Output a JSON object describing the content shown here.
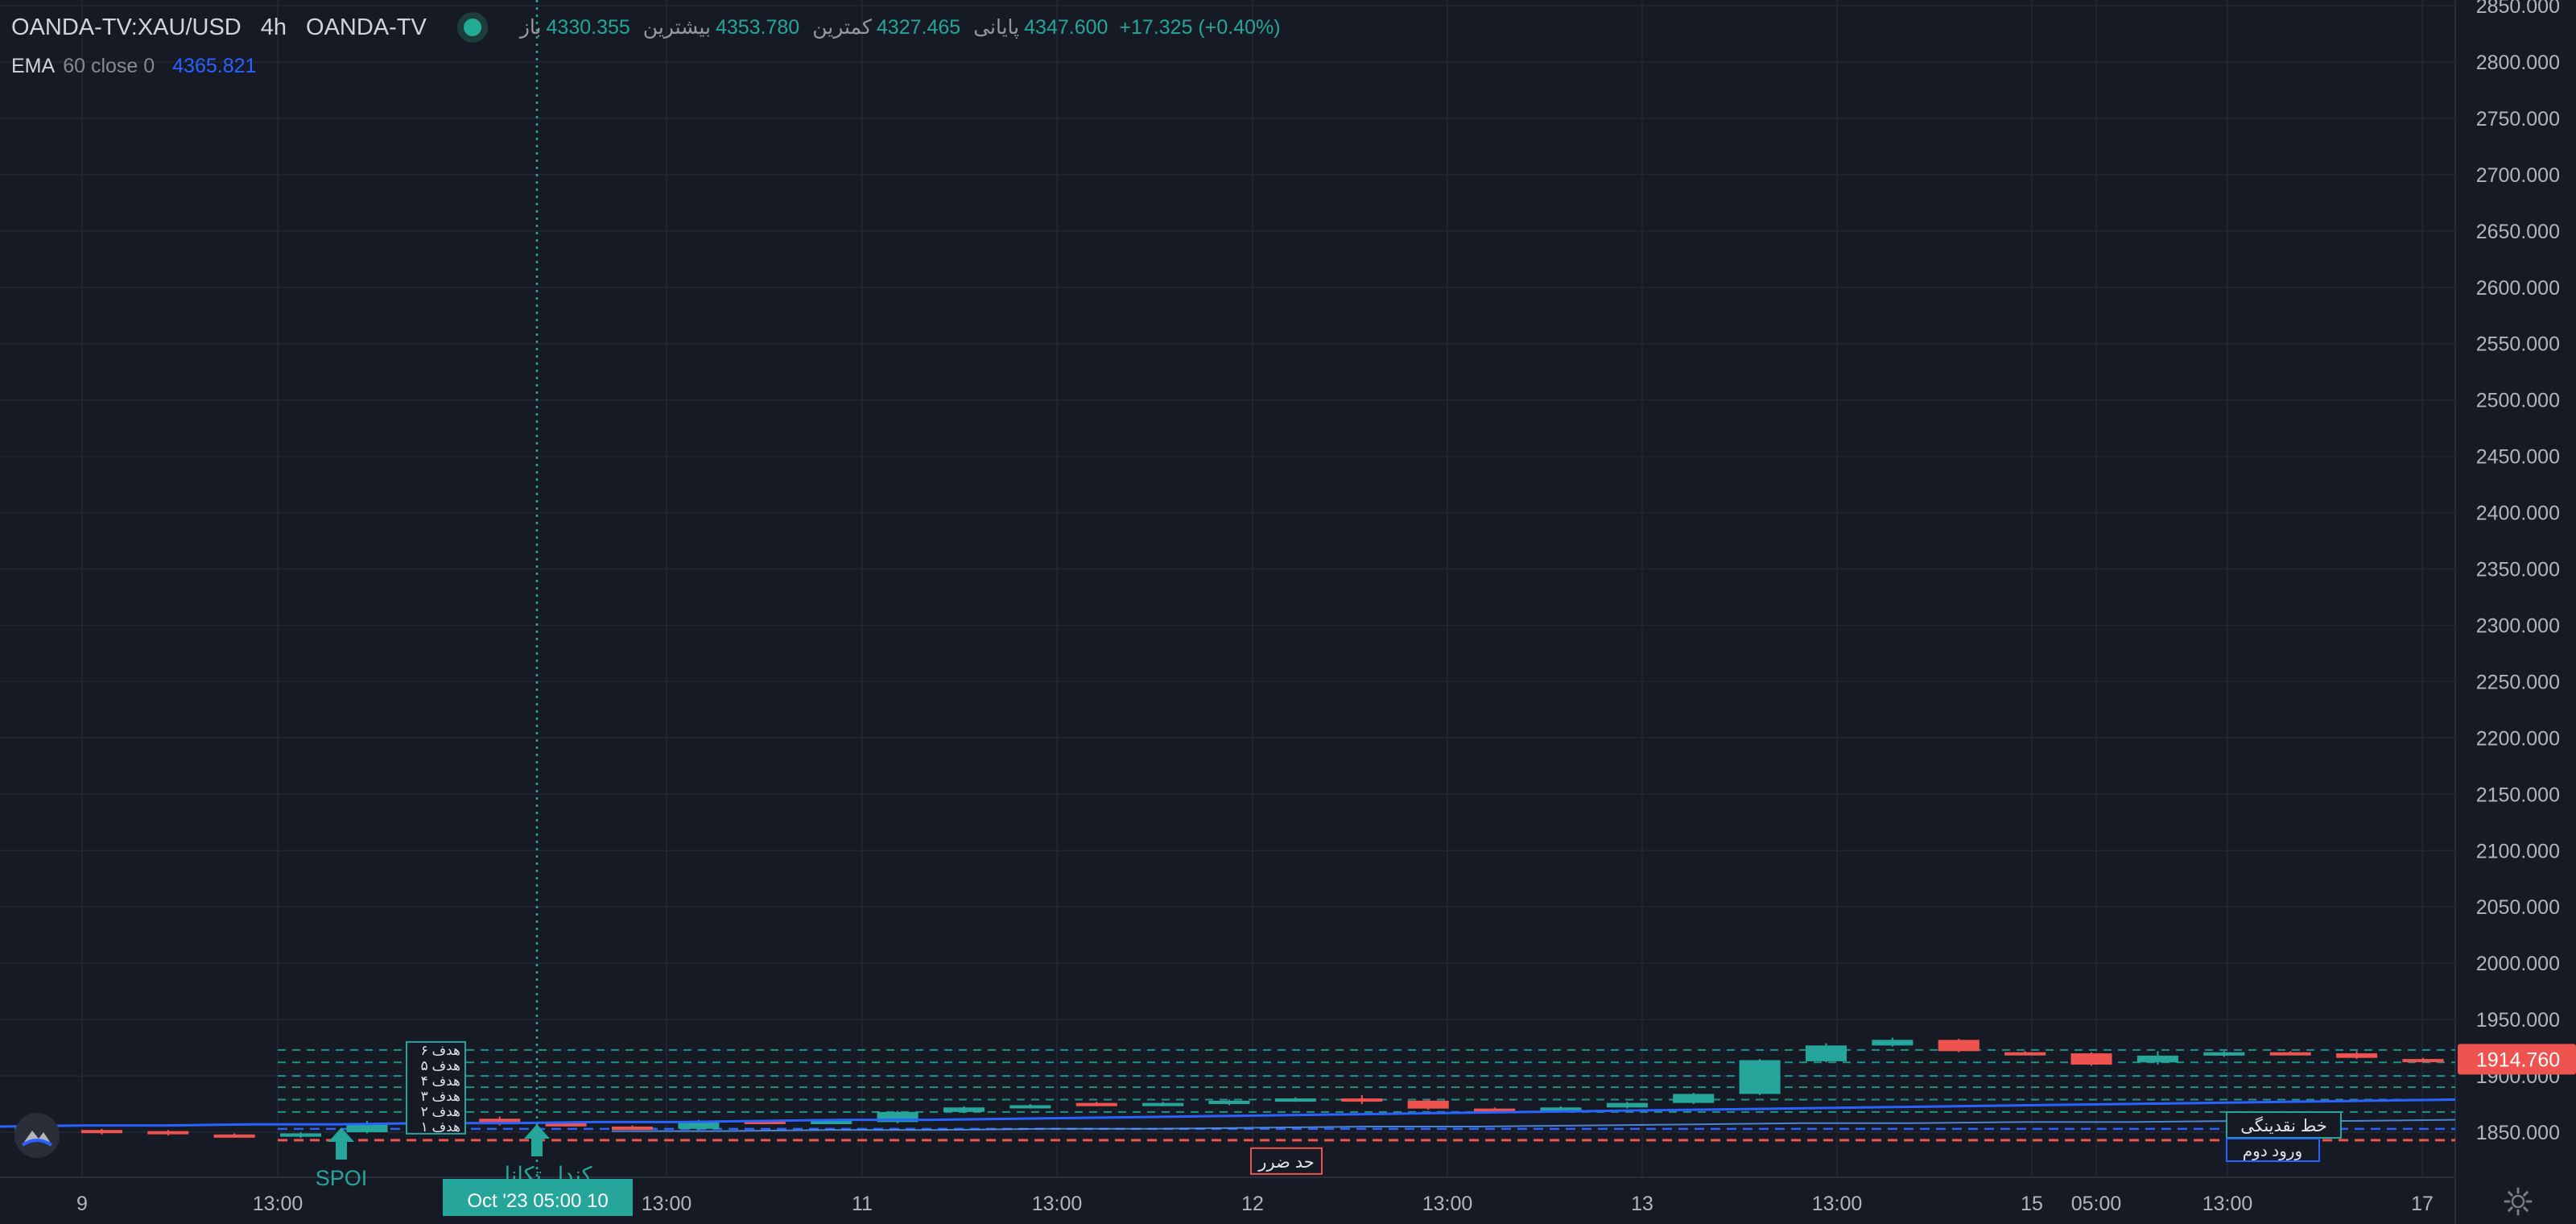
{
  "header": {
    "symbol": "OANDA-TV:XAU/USD",
    "interval": "4h",
    "source": "OANDA-TV",
    "ohlc": [
      {
        "label": "باز",
        "value": "4330.355"
      },
      {
        "label": "بیشترین",
        "value": "4353.780"
      },
      {
        "label": "کمترین",
        "value": "4327.465"
      },
      {
        "label": "پایانی",
        "value": "4347.600"
      }
    ],
    "change": "+17.325 (+0.40%)"
  },
  "indicator": {
    "name": "EMA",
    "params": "60 close 0",
    "value": "4365.821"
  },
  "colors": {
    "background": "#161a25",
    "up": "#26a69a",
    "down": "#ef5350",
    "ema": "#2962ff",
    "text": "#b2b5be"
  },
  "chart_data": {
    "type": "candlestick",
    "y_axis": {
      "range": [
        1810,
        2855
      ],
      "ticks": [
        "2850.000",
        "2800.000",
        "2750.000",
        "2700.000",
        "2650.000",
        "2600.000",
        "2550.000",
        "2500.000",
        "2450.000",
        "2400.000",
        "2350.000",
        "2300.000",
        "2250.000",
        "2200.000",
        "2150.000",
        "2100.000",
        "2050.000",
        "2000.000",
        "1950.000",
        "1900.000",
        "1850.000"
      ]
    },
    "x_axis": {
      "labels": [
        "9",
        "13:00",
        "Oct '23",
        "13:00",
        "11",
        "13:00",
        "12",
        "13:00",
        "13",
        "13:00",
        "15",
        "05:00",
        "13:00",
        "17"
      ],
      "crosshair_label": "Oct '23   05:00 10"
    },
    "last_price": "1914.760",
    "candles": [
      {
        "open": 1842,
        "close": 1855,
        "high": 1858,
        "low": 1838
      },
      {
        "open": 1852,
        "close": 1850,
        "high": 1853,
        "low": 1848
      },
      {
        "open": 1851,
        "close": 1849,
        "high": 1852,
        "low": 1847
      },
      {
        "open": 1848,
        "close": 1846,
        "high": 1849,
        "low": 1845
      },
      {
        "open": 1846,
        "close": 1849,
        "high": 1850,
        "low": 1845
      },
      {
        "open": 1850,
        "close": 1858,
        "high": 1860,
        "low": 1849
      },
      {
        "open": 1856,
        "close": 1861,
        "high": 1862,
        "low": 1855
      },
      {
        "open": 1862,
        "close": 1858,
        "high": 1864,
        "low": 1856
      },
      {
        "open": 1858,
        "close": 1856,
        "high": 1859,
        "low": 1855
      },
      {
        "open": 1855,
        "close": 1853,
        "high": 1856,
        "low": 1852
      },
      {
        "open": 1853,
        "close": 1860,
        "high": 1861,
        "low": 1852
      },
      {
        "open": 1860,
        "close": 1858,
        "high": 1861,
        "low": 1857
      },
      {
        "open": 1858,
        "close": 1860,
        "high": 1861,
        "low": 1857
      },
      {
        "open": 1859,
        "close": 1868,
        "high": 1869,
        "low": 1858
      },
      {
        "open": 1868,
        "close": 1872,
        "high": 1873,
        "low": 1867
      },
      {
        "open": 1872,
        "close": 1874,
        "high": 1875,
        "low": 1871
      },
      {
        "open": 1876,
        "close": 1874,
        "high": 1877,
        "low": 1873
      },
      {
        "open": 1874,
        "close": 1876,
        "high": 1877,
        "low": 1873
      },
      {
        "open": 1875,
        "close": 1878,
        "high": 1879,
        "low": 1874
      },
      {
        "open": 1878,
        "close": 1880,
        "high": 1881,
        "low": 1877
      },
      {
        "open": 1880,
        "close": 1878,
        "high": 1883,
        "low": 1875
      },
      {
        "open": 1878,
        "close": 1871,
        "high": 1879,
        "low": 1870
      },
      {
        "open": 1871,
        "close": 1869,
        "high": 1872,
        "low": 1868
      },
      {
        "open": 1869,
        "close": 1872,
        "high": 1873,
        "low": 1868
      },
      {
        "open": 1872,
        "close": 1876,
        "high": 1877,
        "low": 1871
      },
      {
        "open": 1876,
        "close": 1884,
        "high": 1885,
        "low": 1875
      },
      {
        "open": 1884,
        "close": 1914,
        "high": 1915,
        "low": 1883
      },
      {
        "open": 1913,
        "close": 1927,
        "high": 1929,
        "low": 1912
      },
      {
        "open": 1927,
        "close": 1932,
        "high": 1934,
        "low": 1926
      },
      {
        "open": 1932,
        "close": 1922,
        "high": 1933,
        "low": 1921
      },
      {
        "open": 1921,
        "close": 1919,
        "high": 1922,
        "low": 1918
      },
      {
        "open": 1920,
        "close": 1910,
        "high": 1921,
        "low": 1909
      },
      {
        "open": 1912,
        "close": 1918,
        "high": 1922,
        "low": 1910
      },
      {
        "open": 1918,
        "close": 1921,
        "high": 1922,
        "low": 1917
      },
      {
        "open": 1921,
        "close": 1920,
        "high": 1922,
        "low": 1919
      },
      {
        "open": 1920,
        "close": 1916,
        "high": 1922,
        "low": 1915
      },
      {
        "open": 1915,
        "close": 1914.76,
        "high": 1916,
        "low": 1914
      }
    ],
    "ema_line": [
      1855,
      1856,
      1856,
      1857,
      1857,
      1858,
      1858,
      1859,
      1859,
      1860,
      1861,
      1861,
      1862,
      1863,
      1864,
      1865,
      1866,
      1867,
      1868,
      1869,
      1870,
      1871,
      1872,
      1873,
      1874,
      1875,
      1876,
      1877,
      1878,
      1879
    ],
    "second_line": [
      1851,
      1851,
      1852,
      1852,
      1853,
      1853,
      1854,
      1855,
      1855,
      1856,
      1857,
      1858,
      1858,
      1859,
      1859,
      1860,
      1860,
      1861
    ],
    "target_lines": [
      1923,
      1912,
      1900,
      1890,
      1879,
      1868
    ],
    "stop_line": 1843,
    "entry_line": 1853,
    "target_box_labels": [
      "هدف ۶",
      "هدف ۵",
      "هدف ۴",
      "هدف ۳",
      "هدف ۲",
      "هدف ۱"
    ],
    "annotations": {
      "stop_loss": "حد ضرر",
      "liquidity_line": "خط نقدینگی",
      "second_entry": "ورود دوم",
      "arrow_label_1": "SPOI",
      "arrow_label_2": "کندل تکانا"
    }
  }
}
